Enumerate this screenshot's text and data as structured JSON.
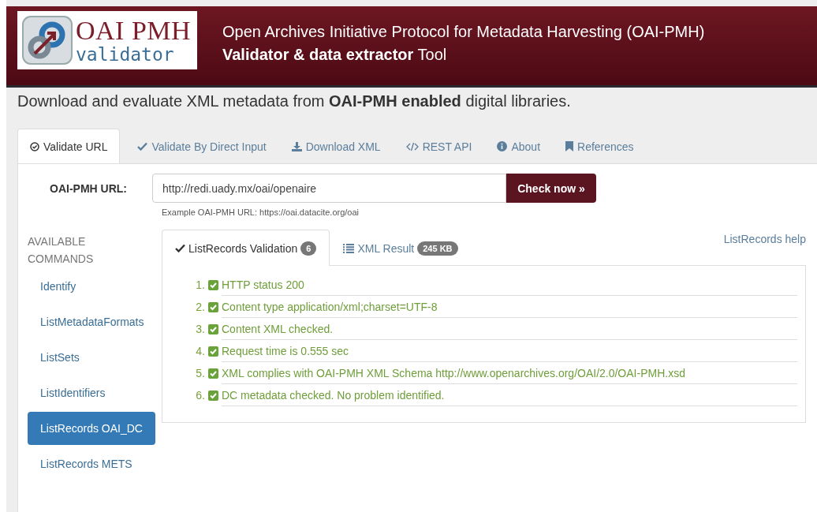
{
  "header": {
    "logo": {
      "line_1": "OAI PMH",
      "line_2": "validator"
    },
    "title": "Open Archives Initiative Protocol for Metadata Harvesting (OAI-PMH)",
    "subtitle": "**Validator & data extractor** Tool"
  },
  "intro": "Download and evaluate XML metadata from **OAI-PMH enabled** digital libraries.",
  "tabs": [
    {
      "label": "Validate URL",
      "kind": "check-circle",
      "selected": true
    },
    {
      "label": "Validate By Direct Input",
      "kind": "check",
      "selected": false
    },
    {
      "label": "Download XML",
      "kind": "download",
      "selected": false
    },
    {
      "label": "REST API",
      "kind": "code",
      "selected": false
    },
    {
      "label": "About",
      "kind": "info",
      "selected": false
    },
    {
      "label": "References",
      "kind": "bookmark",
      "selected": false
    }
  ],
  "url_form": {
    "label": "OAI-PMH URL:",
    "value": "http://redi.uady.mx/oai/openaire",
    "button": "Check now »",
    "example": "Example OAI-PMH URL: https://oai.datacite.org/oai"
  },
  "sidebar": {
    "heading": "AVAILABLE COMMANDS",
    "items": [
      {
        "label": "Identify",
        "selected": false
      },
      {
        "label": "ListMetadataFormats",
        "selected": false
      },
      {
        "label": "ListSets",
        "selected": false
      },
      {
        "label": "ListIdentifiers",
        "selected": false
      },
      {
        "label": "ListRecords OAI_DC",
        "selected": true
      },
      {
        "label": "ListRecords METS",
        "selected": false
      }
    ]
  },
  "result_tabs": [
    {
      "label": "ListRecords Validation",
      "badge": "6",
      "kind": "check",
      "selected": true
    },
    {
      "label": "XML Result",
      "badge": "245 KB",
      "kind": "list",
      "selected": false
    }
  ],
  "help_link": "ListRecords help",
  "checks": [
    {
      "number": "1.",
      "text": "HTTP status 200",
      "checked": true
    },
    {
      "number": "2.",
      "text": "Content type application/xml;charset=UTF-8",
      "checked": true
    },
    {
      "number": "3.",
      "text": "Content XML checked.",
      "checked": true
    },
    {
      "number": "4.",
      "text": "Request time is 0.555 sec",
      "checked": true
    },
    {
      "number": "5.",
      "text": "XML complies with OAI-PMH XML Schema http://www.openarchives.org/OAI/2.0/OAI-PMH.xsd",
      "checked": true
    },
    {
      "number": "6.",
      "text": "DC metadata checked. No problem identified.",
      "checked": true
    }
  ]
}
